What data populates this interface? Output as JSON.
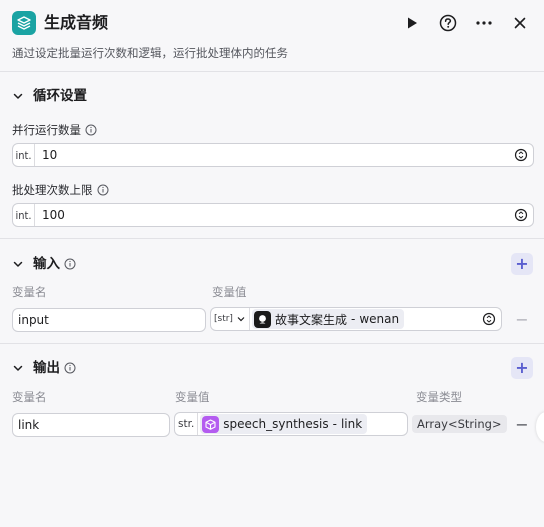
{
  "header": {
    "title": "生成音频",
    "subtitle": "通过设定批量运行次数和逻辑，运行批处理体内的任务",
    "icons": {
      "app": "layers-icon",
      "run": "play-icon",
      "help": "help-circle-icon",
      "more": "more-horizontal-icon",
      "close": "close-icon"
    }
  },
  "loop_settings": {
    "title": "循环设置",
    "concurrency": {
      "label": "并行运行数量",
      "prefix": "int.",
      "value": "10"
    },
    "batch_limit": {
      "label": "批处理次数上限",
      "prefix": "int.",
      "value": "100"
    }
  },
  "input_section": {
    "title": "输入",
    "col_name": "变量名",
    "col_value": "变量值",
    "rows": [
      {
        "name": "input",
        "type_tag": "[str]",
        "ref_node": "故事文案生成",
        "ref_sep": " - ",
        "ref_field": "wenan",
        "ref_icon_color": "#1a1a1a"
      }
    ]
  },
  "output_section": {
    "title": "输出",
    "col_name": "变量名",
    "col_value": "变量值",
    "col_type": "变量类型",
    "rows": [
      {
        "name": "link",
        "type_tag": "str.",
        "ref_node": "speech_synthesis",
        "ref_sep": " - ",
        "ref_field": "link",
        "var_type": "Array<String>",
        "ref_icon_color": "#b45cf0"
      }
    ]
  },
  "colors": {
    "accent": "#5a5ecf",
    "app_icon": "#1aa3a3",
    "add_button_bg": "#e5e6f6"
  }
}
